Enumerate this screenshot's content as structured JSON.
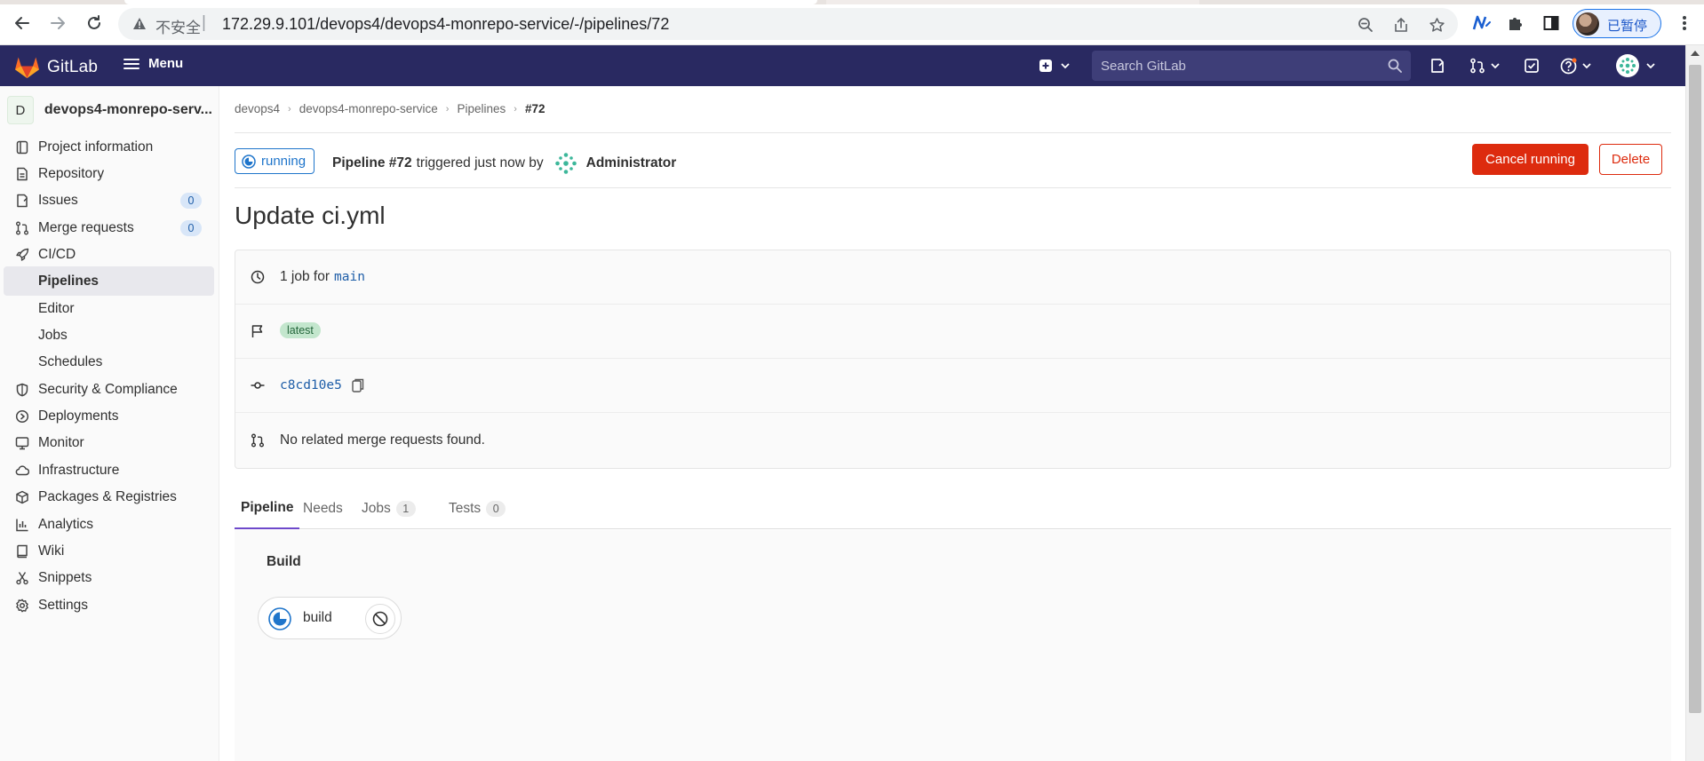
{
  "browser": {
    "insecure_label": "不安全",
    "separator": "|",
    "url": "172.29.9.101/devops4/devops4-monrepo-service/-/pipelines/72",
    "profile_label": "已暂停"
  },
  "topbar": {
    "brand": "GitLab",
    "menu_label": "Menu",
    "search_placeholder": "Search GitLab"
  },
  "sidebar": {
    "project_initial": "D",
    "project_name": "devops4-monrepo-serv...",
    "items": [
      {
        "label": "Project information",
        "icon": "info-doc-icon"
      },
      {
        "label": "Repository",
        "icon": "document-icon"
      },
      {
        "label": "Issues",
        "icon": "issues-icon",
        "count": "0"
      },
      {
        "label": "Merge requests",
        "icon": "merge-request-icon",
        "count": "0"
      },
      {
        "label": "CI/CD",
        "icon": "rocket-icon"
      },
      {
        "label": "Pipelines",
        "active": true
      },
      {
        "label": "Editor"
      },
      {
        "label": "Jobs"
      },
      {
        "label": "Schedules"
      },
      {
        "label": "Security & Compliance",
        "icon": "shield-icon"
      },
      {
        "label": "Deployments",
        "icon": "deployments-icon"
      },
      {
        "label": "Monitor",
        "icon": "monitor-icon"
      },
      {
        "label": "Infrastructure",
        "icon": "cloud-icon"
      },
      {
        "label": "Packages & Registries",
        "icon": "package-icon"
      },
      {
        "label": "Analytics",
        "icon": "chart-icon"
      },
      {
        "label": "Wiki",
        "icon": "book-icon"
      },
      {
        "label": "Snippets",
        "icon": "scissors-icon"
      },
      {
        "label": "Settings",
        "icon": "gear-icon"
      }
    ]
  },
  "breadcrumb": [
    "devops4",
    "devops4-monrepo-service",
    "Pipelines",
    "#72"
  ],
  "pipeline": {
    "status": "running",
    "label": "Pipeline #72",
    "triggered_text": "triggered just now by",
    "user": "Administrator",
    "cancel_label": "Cancel running",
    "delete_label": "Delete",
    "commit_title": "Update ci.yml",
    "jobs_prefix": "1 job for",
    "branch": "main",
    "tag": "latest",
    "sha": "c8cd10e5",
    "mr_text": "No related merge requests found."
  },
  "tabs": [
    {
      "label": "Pipeline",
      "active": true
    },
    {
      "label": "Needs"
    },
    {
      "label": "Jobs",
      "count": "1"
    },
    {
      "label": "Tests",
      "count": "0"
    }
  ],
  "graph": {
    "stage": "Build",
    "job": "build"
  },
  "colors": {
    "navbar": "#292961",
    "accent_blue": "#1f75cb",
    "danger": "#dd2b0e",
    "tab_active": "#6e49cb"
  }
}
